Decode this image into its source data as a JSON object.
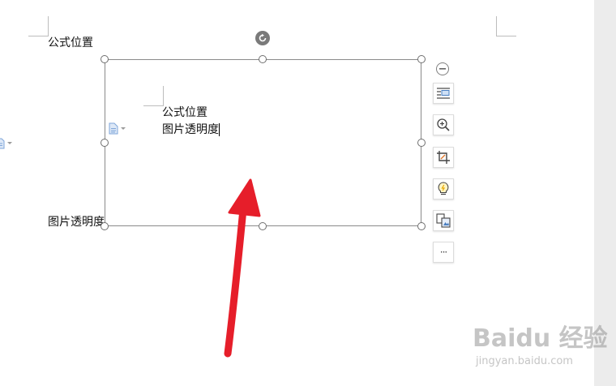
{
  "document": {
    "body_line_1": "公式位置",
    "body_line_2": "图片透明度"
  },
  "image": {
    "text_line_1": "公式位置",
    "text_line_2": "图片透明度"
  },
  "image_toolbar": {
    "items": [
      {
        "icon": "text-wrap-icon"
      },
      {
        "icon": "zoom-in-icon"
      },
      {
        "icon": "crop-icon"
      },
      {
        "icon": "lightbulb-icon"
      },
      {
        "icon": "image-convert-icon"
      },
      {
        "icon": "more-icon",
        "label": "···"
      }
    ]
  },
  "colors": {
    "annotation_arrow": "#e61e2a",
    "frame_border": "#8a8a8a",
    "paste_icon": "#7fa6d9"
  },
  "watermark": {
    "brand": "Baidu 经验",
    "url": "jingyan.baidu.com"
  }
}
